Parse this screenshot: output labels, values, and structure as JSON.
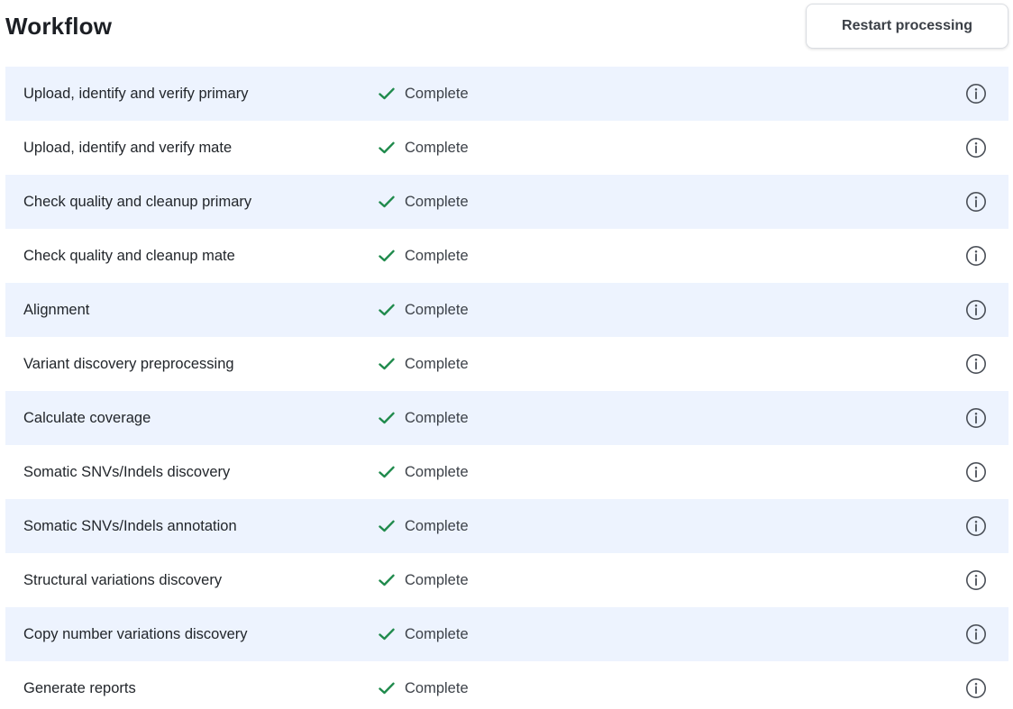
{
  "header": {
    "title": "Workflow",
    "restart_label": "Restart processing"
  },
  "colors": {
    "row_alt": "#edf3fe",
    "check_green": "#1f8a4c",
    "icon_gray": "#4a4f57"
  },
  "steps": [
    {
      "name": "Upload, identify and verify primary",
      "status": "Complete",
      "status_icon": "check-icon",
      "info_icon": "info-icon"
    },
    {
      "name": "Upload, identify and verify mate",
      "status": "Complete",
      "status_icon": "check-icon",
      "info_icon": "info-icon"
    },
    {
      "name": "Check quality and cleanup primary",
      "status": "Complete",
      "status_icon": "check-icon",
      "info_icon": "info-icon"
    },
    {
      "name": "Check quality and cleanup mate",
      "status": "Complete",
      "status_icon": "check-icon",
      "info_icon": "info-icon"
    },
    {
      "name": "Alignment",
      "status": "Complete",
      "status_icon": "check-icon",
      "info_icon": "info-icon"
    },
    {
      "name": "Variant discovery preprocessing",
      "status": "Complete",
      "status_icon": "check-icon",
      "info_icon": "info-icon"
    },
    {
      "name": "Calculate coverage",
      "status": "Complete",
      "status_icon": "check-icon",
      "info_icon": "info-icon"
    },
    {
      "name": "Somatic SNVs/Indels discovery",
      "status": "Complete",
      "status_icon": "check-icon",
      "info_icon": "info-icon"
    },
    {
      "name": "Somatic SNVs/Indels annotation",
      "status": "Complete",
      "status_icon": "check-icon",
      "info_icon": "info-icon"
    },
    {
      "name": "Structural variations discovery",
      "status": "Complete",
      "status_icon": "check-icon",
      "info_icon": "info-icon"
    },
    {
      "name": "Copy number variations discovery",
      "status": "Complete",
      "status_icon": "check-icon",
      "info_icon": "info-icon"
    },
    {
      "name": "Generate reports",
      "status": "Complete",
      "status_icon": "check-icon",
      "info_icon": "info-icon"
    }
  ]
}
